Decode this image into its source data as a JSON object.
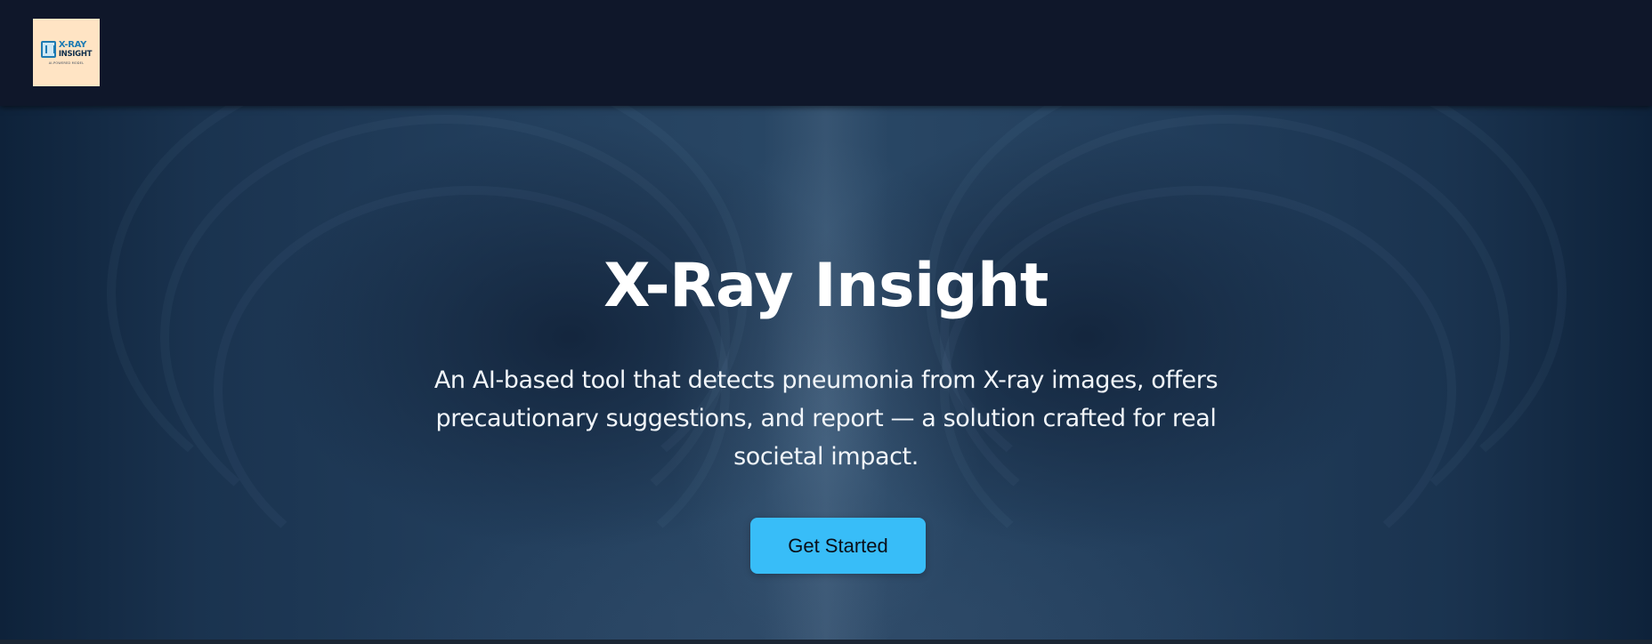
{
  "header": {
    "logo": {
      "line1": "X-RAY",
      "line2": "INSIGHT",
      "tagline": "AI-POWERED MODEL"
    }
  },
  "hero": {
    "title": "X-Ray Insight",
    "subtitle": "An AI-based tool that detects pneumonia from X-ray images, offers precautionary suggestions, and report — a solution crafted for real societal impact.",
    "cta_label": "Get Started"
  },
  "colors": {
    "topbar": "#0f172a",
    "accent": "#38bdf8",
    "logo_bg": "#ffe4c4"
  }
}
